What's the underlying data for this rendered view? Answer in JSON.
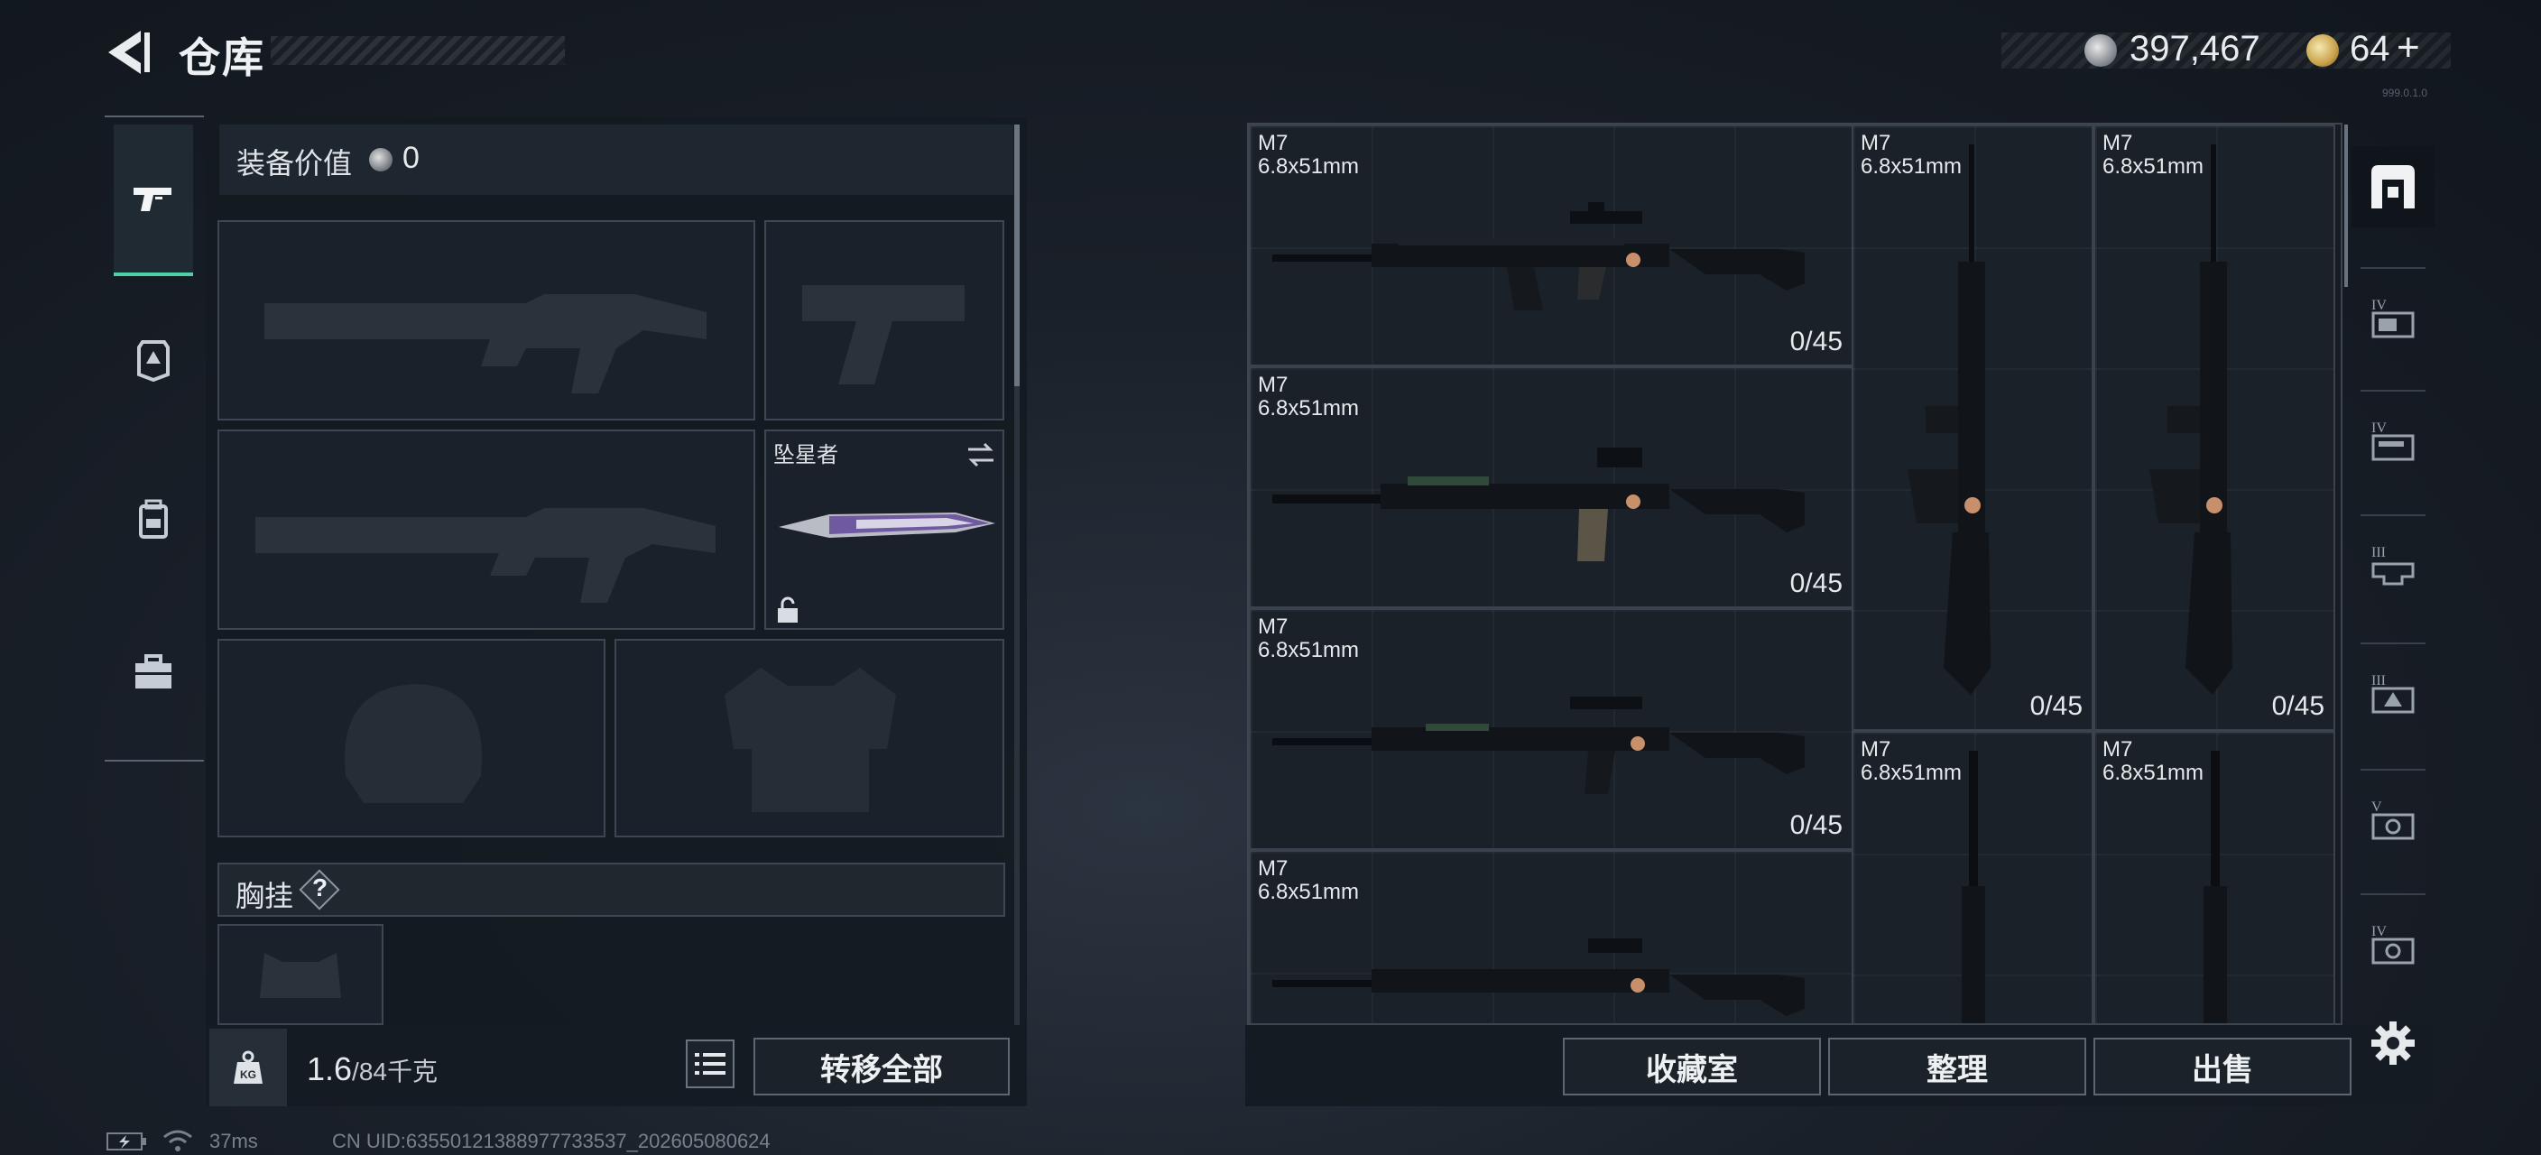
{
  "header": {
    "title": "仓库",
    "currency_silver": "397,467",
    "currency_gold": "64",
    "currency_gold_plus": "+",
    "version": "999.0.1.0"
  },
  "sidebar": {
    "tabs": [
      {
        "name": "weapons",
        "icon": "pistol-icon",
        "active": true
      },
      {
        "name": "armor",
        "icon": "armor-badge-icon",
        "active": false
      },
      {
        "name": "backpack",
        "icon": "backpack-icon",
        "active": false
      },
      {
        "name": "toolbox",
        "icon": "toolbox-icon",
        "active": false
      }
    ]
  },
  "loadout": {
    "value_label": "装备价值",
    "value": "0",
    "melee_name": "坠星者",
    "chest_label": "胸挂",
    "help_symbol": "?",
    "weight_current": "1.6",
    "weight_max": "/84千克",
    "transfer_all": "转移全部"
  },
  "storage": {
    "items": [
      {
        "name": "M7",
        "caliber": "6.8x51mm",
        "count": "0/45"
      },
      {
        "name": "M7",
        "caliber": "6.8x51mm",
        "count": "0/45"
      },
      {
        "name": "M7",
        "caliber": "6.8x51mm",
        "count": "0/45"
      },
      {
        "name": "M7",
        "caliber": "6.8x51mm",
        "count": ""
      },
      {
        "name": "M7",
        "caliber": "6.8x51mm",
        "count": "0/45"
      },
      {
        "name": "M7",
        "caliber": "6.8x51mm",
        "count": "0/45"
      },
      {
        "name": "M7",
        "caliber": "6.8x51mm",
        "count": ""
      },
      {
        "name": "M7",
        "caliber": "6.8x51mm",
        "count": ""
      }
    ],
    "buttons": {
      "collection": "收藏室",
      "sort": "整理",
      "sell": "出售"
    }
  },
  "right_tabs": [
    {
      "icon": "all-items-icon",
      "tier": ""
    },
    {
      "icon": "tier-iv-container-icon",
      "tier": "IV"
    },
    {
      "icon": "tier-iv-container-icon",
      "tier": "IV"
    },
    {
      "icon": "tier-iii-container-icon",
      "tier": "III"
    },
    {
      "icon": "tier-iii-container-icon",
      "tier": "III"
    },
    {
      "icon": "tier-v-container-icon",
      "tier": "V"
    },
    {
      "icon": "tier-iv-container-icon",
      "tier": "IV"
    }
  ],
  "status_bar": {
    "ping": "37ms",
    "uid": "CN UID:6355012138897773353​7_202605080624"
  },
  "colors": {
    "accent": "#4fd1a8",
    "panel": "#1a212a",
    "border": "#3d4753"
  }
}
